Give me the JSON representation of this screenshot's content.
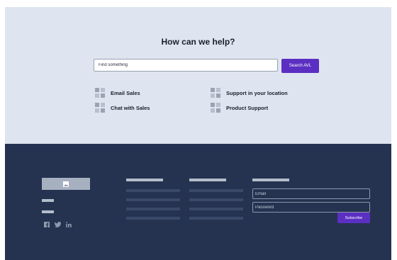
{
  "help": {
    "title": "How can we help?",
    "search_placeholder": "Find something",
    "search_button": "Search AVL",
    "links": [
      {
        "label": "Email Sales",
        "icon": "grid-icon"
      },
      {
        "label": "Support in your location",
        "icon": "grid-icon"
      },
      {
        "label": "Chat with Sales",
        "icon": "grid-icon"
      },
      {
        "label": "Product Support",
        "icon": "grid-icon"
      }
    ]
  },
  "footer": {
    "logo_icon": "image-placeholder-icon",
    "newsletter": {
      "email_placeholder": "Email",
      "password_placeholder": "Password",
      "subscribe_label": "Subscribe"
    },
    "social": [
      {
        "icon": "facebook-icon",
        "glyph": "f"
      },
      {
        "icon": "twitter-icon",
        "glyph": "t"
      },
      {
        "icon": "linkedin-icon",
        "glyph": "in"
      }
    ]
  },
  "colors": {
    "accent": "#5b2fc2",
    "help_background": "#dfe5f0",
    "footer_background": "#253351"
  }
}
